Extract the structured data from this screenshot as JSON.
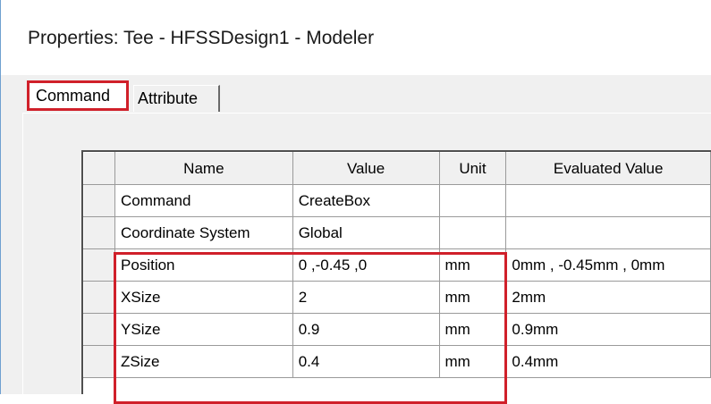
{
  "window": {
    "title": "Properties: Tee - HFSSDesign1 - Modeler"
  },
  "tabs": [
    {
      "label": "Command",
      "selected": true
    },
    {
      "label": "Attribute",
      "selected": false
    }
  ],
  "grid": {
    "columns": [
      "Name",
      "Value",
      "Unit",
      "Evaluated Value"
    ],
    "rows": [
      {
        "name": "Command",
        "value": "CreateBox",
        "unit": "",
        "evaluated": ""
      },
      {
        "name": "Coordinate System",
        "value": "Global",
        "unit": "",
        "evaluated": ""
      },
      {
        "name": "Position",
        "value": "0 ,-0.45 ,0",
        "unit": "mm",
        "evaluated": "0mm , -0.45mm , 0mm"
      },
      {
        "name": "XSize",
        "value": "2",
        "unit": "mm",
        "evaluated": "2mm"
      },
      {
        "name": "YSize",
        "value": "0.9",
        "unit": "mm",
        "evaluated": "0.9mm"
      },
      {
        "name": "ZSize",
        "value": "0.4",
        "unit": "mm",
        "evaluated": "0.4mm"
      }
    ]
  },
  "colors": {
    "highlight": "#d0202a",
    "panel": "#f0f0f0"
  }
}
